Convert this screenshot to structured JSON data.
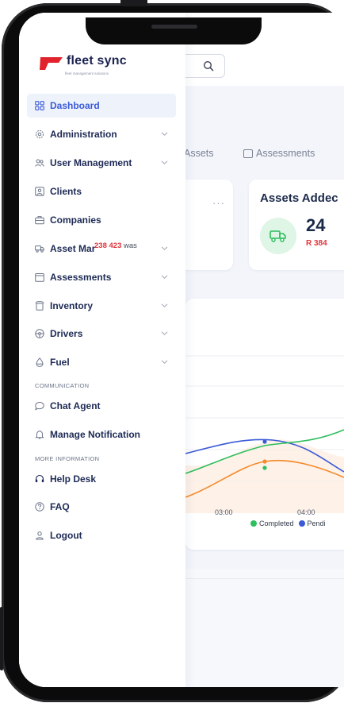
{
  "app": {
    "logo_text": "fleet sync",
    "logo_tagline": "fleet management solutions"
  },
  "colors": {
    "accent": "#3b5bd6",
    "nav_text": "#1d2a55",
    "logo_red": "#e0232c",
    "completed_series": "#2fbf5e",
    "pending_series": "#3b5bd6",
    "third_series": "#f58a2a",
    "negative_value": "#e0343c"
  },
  "sidebar": {
    "items": [
      {
        "label": "Dashboard",
        "icon": "grid-icon",
        "active": true,
        "has_chevron": false
      },
      {
        "label": "Administration",
        "icon": "gear-icon",
        "active": false,
        "has_chevron": true
      },
      {
        "label": "User Management",
        "icon": "users-icon",
        "active": false,
        "has_chevron": true
      },
      {
        "label": "Clients",
        "icon": "client-icon",
        "active": false,
        "has_chevron": false
      },
      {
        "label": "Companies",
        "icon": "briefcase-icon",
        "active": false,
        "has_chevron": false
      },
      {
        "label": "Asset Mar",
        "icon": "truck-icon",
        "active": false,
        "has_chevron": true
      },
      {
        "label": "Assessments",
        "icon": "calendar-icon",
        "active": false,
        "has_chevron": true
      },
      {
        "label": "Inventory",
        "icon": "box-icon",
        "active": false,
        "has_chevron": true
      },
      {
        "label": "Drivers",
        "icon": "steering-wheel-icon",
        "active": false,
        "has_chevron": true
      },
      {
        "label": "Fuel",
        "icon": "droplet-icon",
        "active": false,
        "has_chevron": true
      },
      {
        "label": "Chat Agent",
        "icon": "chat-icon",
        "active": false,
        "has_chevron": false
      },
      {
        "label": "Manage Notification",
        "icon": "bell-icon",
        "active": false,
        "has_chevron": false
      },
      {
        "label": "Help Desk",
        "icon": "headset-icon",
        "active": false,
        "has_chevron": false
      },
      {
        "label": "FAQ",
        "icon": "question-icon",
        "active": false,
        "has_chevron": false
      },
      {
        "label": "Logout",
        "icon": "user-logout-icon",
        "active": false,
        "has_chevron": false
      }
    ],
    "sections": {
      "communication": "COMMUNICATION",
      "more_information": "MORE INFORMATION"
    },
    "overlay_text": {
      "num1": "238",
      "num2": "423",
      "word": "was"
    }
  },
  "background": {
    "tabs": [
      {
        "label": "Assets",
        "icon": "truck-icon"
      },
      {
        "label": "Assessments",
        "icon": "calendar-icon"
      }
    ],
    "card_menu": "···",
    "assets_card": {
      "title": "Assets Addec",
      "value": "24",
      "sub": "R 384"
    },
    "chart": {
      "x_ticks": [
        "03:00",
        "04:00"
      ],
      "legend": [
        {
          "label": "Completed",
          "color": "#2fbf5e"
        },
        {
          "label": "Pendi",
          "color": "#3b5bd6"
        }
      ]
    }
  }
}
